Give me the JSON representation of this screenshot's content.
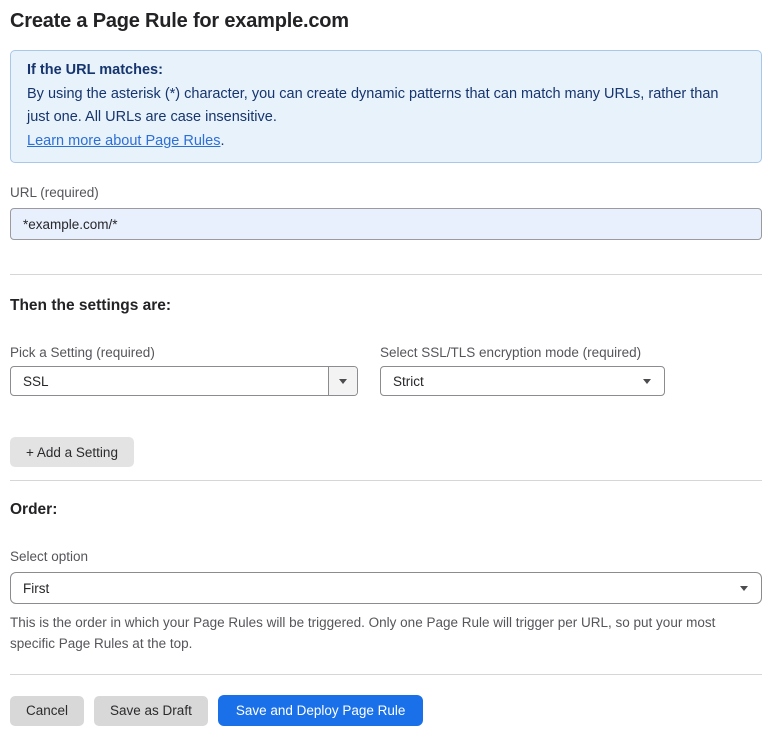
{
  "page": {
    "title": "Create a Page Rule for example.com"
  },
  "info_box": {
    "heading": "If the URL matches:",
    "body": "By using the asterisk (*) character, you can create dynamic patterns that can match many URLs, rather than just one. All URLs are case insensitive.",
    "link_label": "Learn more about Page Rules",
    "link_suffix": "."
  },
  "url_field": {
    "label": "URL (required)",
    "value": "*example.com/*"
  },
  "settings_section": {
    "heading": "Then the settings are:",
    "setting_select": {
      "label": "Pick a Setting (required)",
      "value": "SSL"
    },
    "mode_select": {
      "label": "Select SSL/TLS encryption mode (required)",
      "value": "Strict"
    },
    "add_setting_label": "+ Add a Setting"
  },
  "order_section": {
    "heading": "Order:",
    "order_select": {
      "label": "Select option",
      "value": "First"
    },
    "help_text": "This is the order in which your Page Rules will be triggered. Only one Page Rule will trigger per URL, so put your most specific Page Rules at the top."
  },
  "footer": {
    "cancel_label": "Cancel",
    "save_draft_label": "Save as Draft",
    "save_deploy_label": "Save and Deploy Page Rule"
  },
  "colors": {
    "info_box_bg": "#e8f2fb",
    "info_box_border": "#a9c7e9",
    "info_box_text": "#16356e",
    "link_blue": "#2c6fd6",
    "url_input_bg": "#e8f0fe",
    "primary_button_blue": "#1a70e8",
    "gray_button_bg": "#d8d8d8",
    "label_gray": "#55555b"
  }
}
